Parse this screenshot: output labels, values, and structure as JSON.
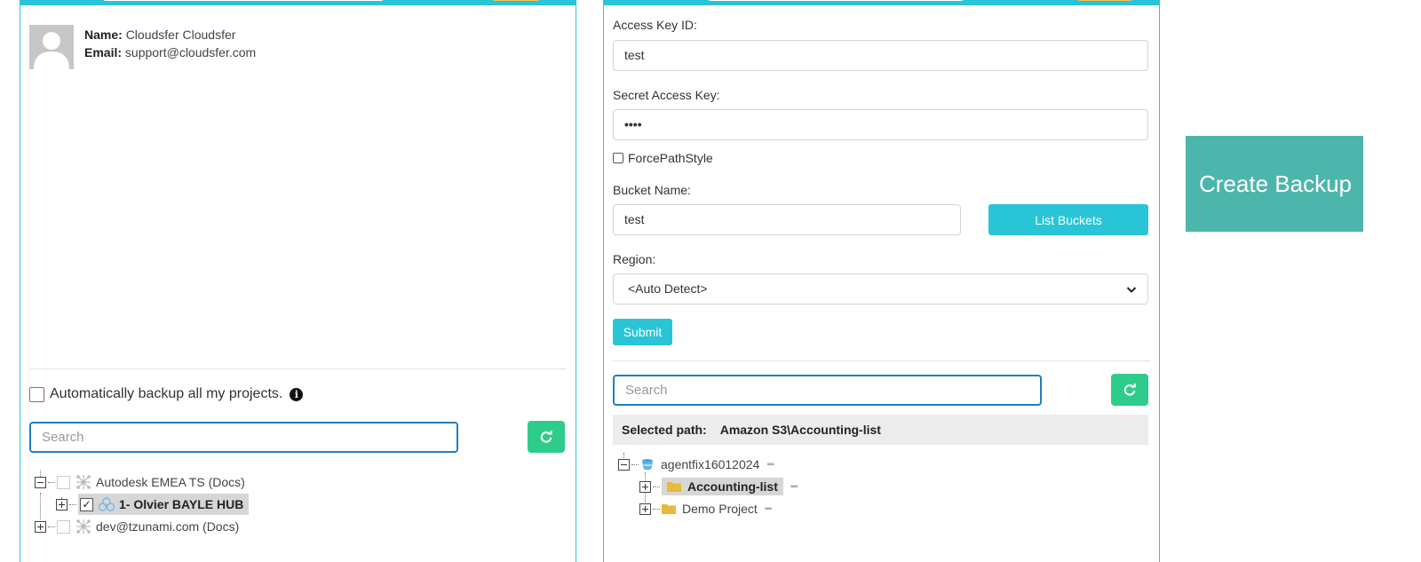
{
  "left_panel": {
    "user": {
      "name_label": "Name:",
      "name_value": "Cloudsfer Cloudsfer",
      "email_label": "Email:",
      "email_value": "support@cloudsfer.com"
    },
    "auto_backup_label": "Automatically backup all my projects.",
    "search_placeholder": "Search",
    "tree": [
      {
        "label": "Autodesk EMEA TS (Docs)",
        "expanded": true,
        "checked": false
      },
      {
        "label": "1- Olvier BAYLE HUB",
        "expanded": false,
        "checked": true,
        "selected": true
      },
      {
        "label": "dev@tzunami.com (Docs)",
        "expanded": false,
        "checked": false
      }
    ]
  },
  "right_panel": {
    "access_key_label": "Access Key ID:",
    "access_key_value": "test",
    "secret_key_label": "Secret Access Key:",
    "secret_key_value": "••••",
    "force_path_style_label": "ForcePathStyle",
    "bucket_name_label": "Bucket Name:",
    "bucket_name_value": "test",
    "list_buckets_label": "List Buckets",
    "region_label": "Region:",
    "region_value": "<Auto Detect>",
    "submit_label": "Submit",
    "search_placeholder": "Search",
    "selected_path_label": "Selected path:",
    "selected_path_value": "Amazon S3\\Accounting-list",
    "tree": [
      {
        "label": "agentfix16012024",
        "expanded": true
      },
      {
        "label": "Accounting-list",
        "expanded": false,
        "selected": true
      },
      {
        "label": "Demo Project",
        "expanded": false
      }
    ]
  },
  "create_backup_label": "Create Backup",
  "colors": {
    "teal_border": "#29c5d6",
    "green_button": "#2ecc8a",
    "create_backup": "#4db6ac",
    "folder": "#e8b93a",
    "search_border": "#1e7fc1"
  },
  "icons": [
    "person-avatar-icon",
    "info-icon",
    "refresh-icon",
    "hub-network-icon",
    "cloud-hub-icon",
    "bucket-icon",
    "folder-icon",
    "chevron-down-icon"
  ]
}
